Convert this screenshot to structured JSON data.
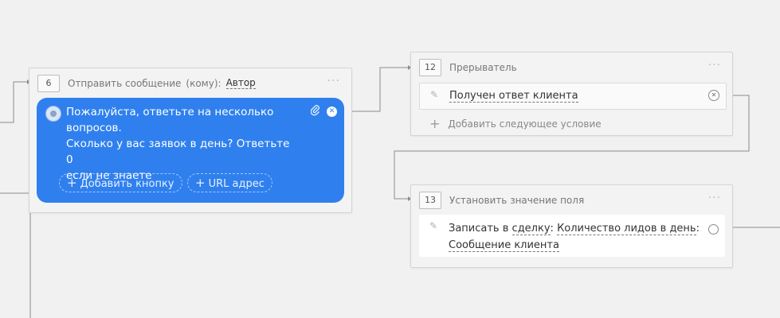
{
  "node6": {
    "number": "6",
    "title": "Отправить сообщение",
    "recipient_label": "(кому):",
    "recipient": "Автор",
    "menu": "···",
    "message": "Пожалуйста, ответьте на несколько\nвопросов.\nСколько у вас заявок в день? Ответьте 0\nесли не знаете",
    "add_button_label": "Добавить кнопку",
    "url_button_label": "URL адрес",
    "bubble_color": "#2f80ee"
  },
  "node12": {
    "number": "12",
    "title": "Прерыватель",
    "menu": "···",
    "condition": "Получен ответ клиента",
    "add_condition_label": "Добавить следующее условие"
  },
  "node13": {
    "number": "13",
    "title": "Установить значение поля",
    "menu": "···",
    "action_prefix": "Записать в",
    "entity": "сделку",
    "field": "Количество лидов в день",
    "value": "Сообщение клиента"
  },
  "icons": {
    "avatar": "avatar-icon",
    "paperclip": "paperclip-icon",
    "close": "close-icon",
    "pencil": "pencil-icon",
    "plus": "plus-icon"
  }
}
